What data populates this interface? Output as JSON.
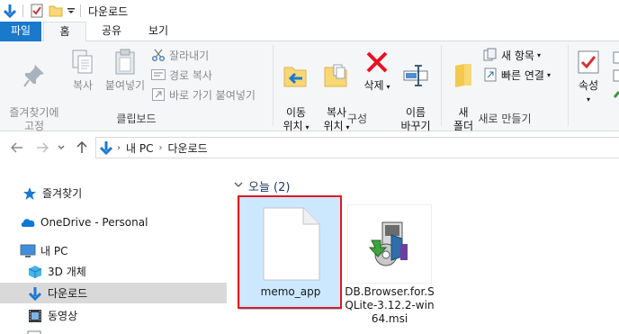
{
  "window": {
    "title": "다운로드"
  },
  "ribbon": {
    "tabs": {
      "file": "파일",
      "home": "홈",
      "share": "공유",
      "view": "보기"
    },
    "clipboard": {
      "pin": "즐겨찾기에\n고정",
      "copy": "복사",
      "paste": "붙여넣기",
      "cut": "잘라내기",
      "copy_path": "경로 복사",
      "paste_shortcut": "바로 가기 붙여넣기",
      "group_label": "클립보드"
    },
    "organize": {
      "move_to": "이동\n위치",
      "copy_to": "복사\n위치",
      "delete": "삭제",
      "rename": "이름\n바꾸기",
      "group_label": "구성"
    },
    "new": {
      "new_folder": "새\n폴더",
      "new_item": "새 항목",
      "easy_access": "빠른 연결",
      "group_label": "새로 만들기"
    },
    "open": {
      "properties": "속성"
    }
  },
  "address": {
    "crumbs": [
      "내 PC",
      "다운로드"
    ]
  },
  "navpane": {
    "items": [
      {
        "label": "즐겨찾기",
        "icon": "star-icon"
      },
      {
        "label": "OneDrive - Personal",
        "icon": "cloud-icon"
      },
      {
        "label": "내 PC",
        "icon": "computer-icon"
      },
      {
        "label": "3D 개체",
        "icon": "cube-icon"
      },
      {
        "label": "다운로드",
        "icon": "download-icon"
      },
      {
        "label": "동영상",
        "icon": "video-icon"
      }
    ]
  },
  "content": {
    "group_header": "오늘 (2)",
    "files": [
      {
        "name": "memo_app",
        "icon": "blank-file-icon"
      },
      {
        "name": "DB.Browser.for.SQLite-3.12.2-win64.msi",
        "icon": "installer-icon"
      }
    ]
  },
  "colors": {
    "file_tab": "#1979ca",
    "selection": "#cce8ff",
    "highlight_box": "#e0181e",
    "delete_red": "#e81123"
  }
}
